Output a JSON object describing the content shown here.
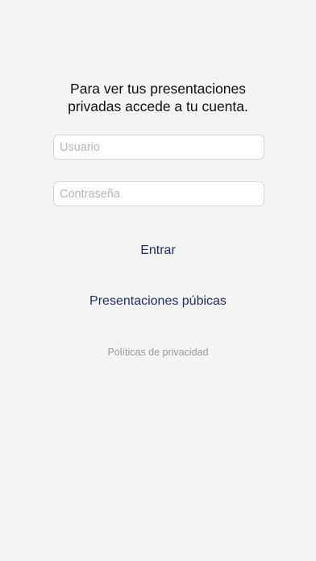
{
  "login": {
    "headline_line1": "Para ver tus presentaciones",
    "headline_line2": "privadas accede a tu cuenta.",
    "username": {
      "value": "",
      "placeholder": "Usuario"
    },
    "password": {
      "value": "",
      "placeholder": "Contraseña"
    },
    "submit_label": "Entrar",
    "public_presentations_label": "Presentaciones púbicas",
    "privacy_label": "Políticas de privacidad"
  },
  "colors": {
    "background": "#f4f4f4",
    "link_accent": "#1f2f6a",
    "muted_text": "#9a9a9a",
    "field_border": "#d6d6d6"
  }
}
